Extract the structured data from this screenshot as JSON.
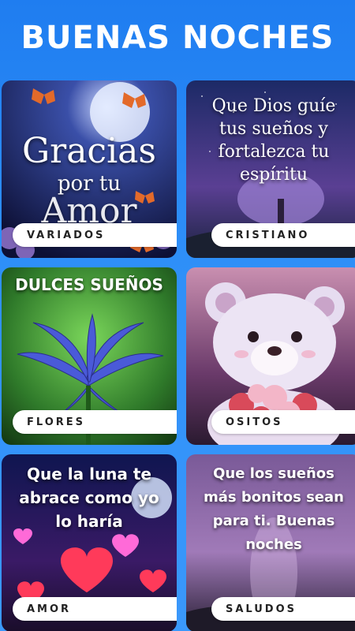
{
  "header": {
    "title": "BUENAS NOCHES"
  },
  "cards": [
    {
      "label": "VARIADOS",
      "art_text": [
        "Gracias",
        "por tu",
        "Amor"
      ]
    },
    {
      "label": "CRISTIANO",
      "art_text": [
        "Que Dios guíe",
        "tus sueños y",
        "fortalezca tu",
        "espíritu"
      ]
    },
    {
      "label": "FLORES",
      "art_text": [
        "DULCES SUEÑOS"
      ]
    },
    {
      "label": "OSITOS",
      "art_text": []
    },
    {
      "label": "AMOR",
      "art_text": [
        "Que la luna te",
        "abrace como yo",
        "lo haría"
      ]
    },
    {
      "label": "SALUDOS",
      "art_text": [
        "Que los sueños",
        "más bonitos sean",
        "para ti. Buenas",
        "noches"
      ]
    }
  ],
  "colors": {
    "background": "#2e8ff8",
    "pill": "#ffffff",
    "pill_text": "#222222"
  }
}
